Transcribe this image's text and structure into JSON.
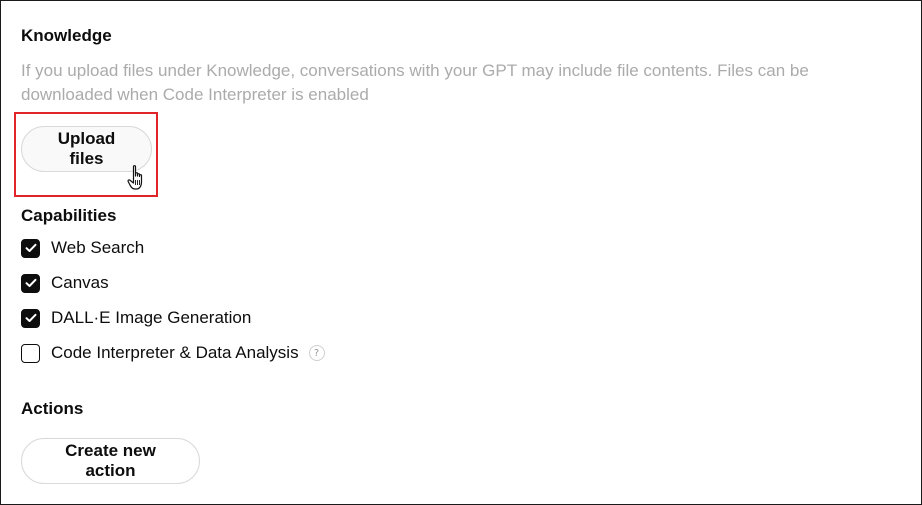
{
  "knowledge": {
    "title": "Knowledge",
    "description": "If you upload files under Knowledge, conversations with your GPT may include file contents. Files can be downloaded when Code Interpreter is enabled",
    "upload_button_label": "Upload files"
  },
  "capabilities": {
    "title": "Capabilities",
    "items": [
      {
        "label": "Web Search",
        "checked": true
      },
      {
        "label": "Canvas",
        "checked": true
      },
      {
        "label": "DALL·E Image Generation",
        "checked": true
      },
      {
        "label": "Code Interpreter & Data Analysis",
        "checked": false
      }
    ],
    "help_icon_glyph": "?"
  },
  "actions": {
    "title": "Actions",
    "create_button_label": "Create new action"
  },
  "colors": {
    "highlight": "#e0242a",
    "text": "#0d0d0d",
    "muted": "#ababab"
  },
  "icons": {
    "check": "checkmark-icon",
    "help": "question-mark-icon",
    "cursor": "hand-pointer-icon"
  }
}
